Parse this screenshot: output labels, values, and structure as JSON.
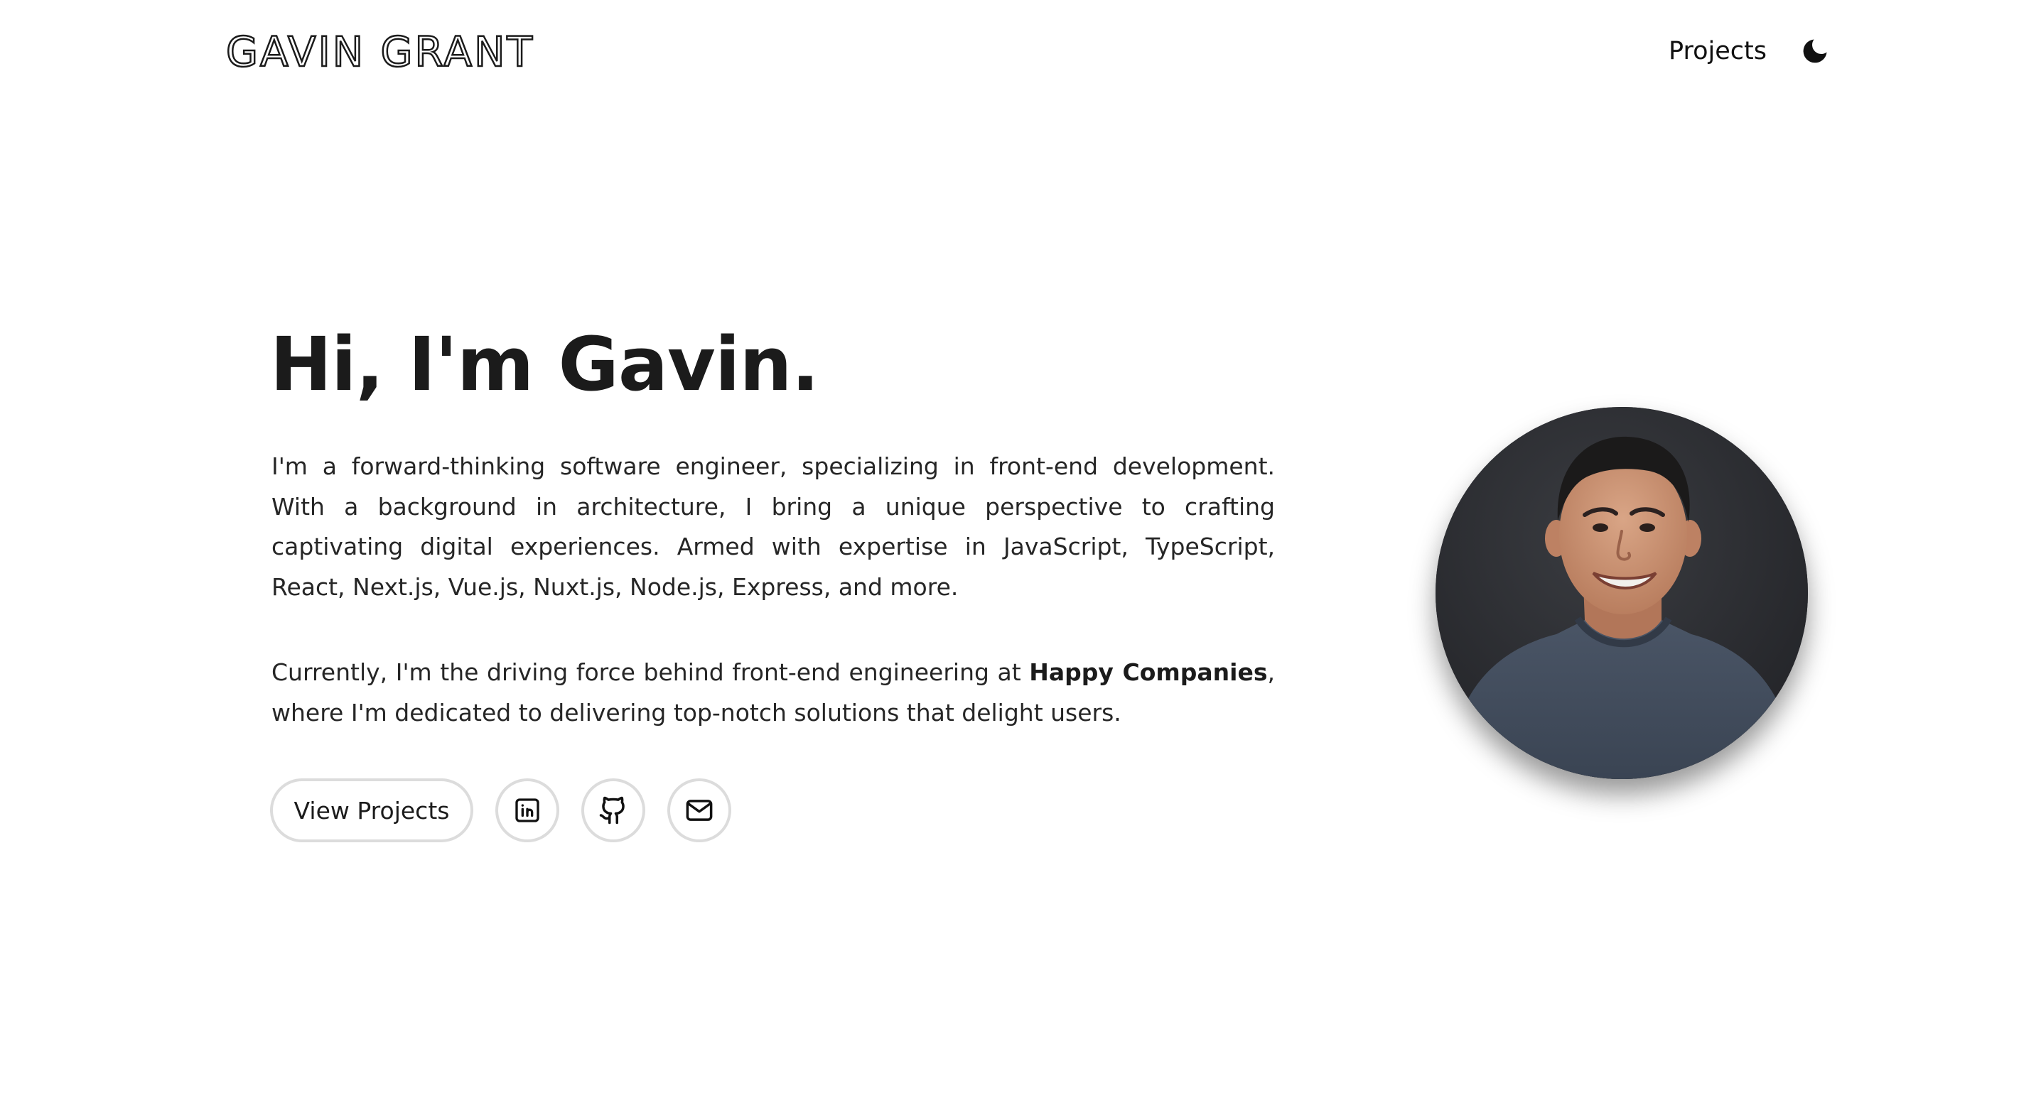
{
  "header": {
    "logo_text": "GAVIN GRANT",
    "nav": {
      "projects_label": "Projects"
    },
    "theme_toggle_icon": "moon-icon"
  },
  "hero": {
    "title": "Hi, I'm Gavin.",
    "paragraph1": "I'm a forward-thinking software engineer, specializing in front-end development. With a background in architecture, I bring a unique perspective to crafting captivating digital experiences. Armed with expertise in JavaScript, TypeScript, React, Next.js, Vue.js, Nuxt.js, Node.js, Express, and more.",
    "paragraph2": {
      "before": "Currently, I'm the driving force behind front-end engineering at ",
      "company": "Happy Companies",
      "after": ", where I'm dedicated to delivering top-notch solutions that delight users."
    },
    "actions": {
      "view_projects_label": "View Projects",
      "icons": [
        "linkedin-icon",
        "github-icon",
        "mail-icon"
      ]
    }
  },
  "colors": {
    "text": "#1b1b1b",
    "button_border": "#dcdcdc",
    "background": "#ffffff"
  }
}
